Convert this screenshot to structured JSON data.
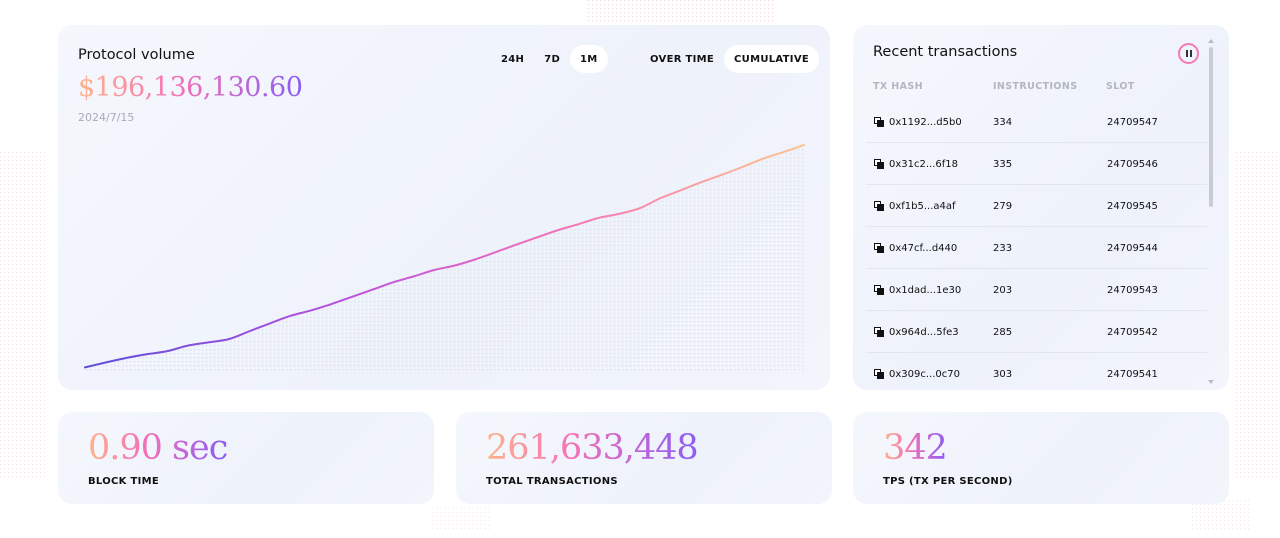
{
  "volume": {
    "title": "Protocol volume",
    "amount": "$196,136,130.60",
    "date": "2024/7/15",
    "range_options": [
      "24H",
      "7D",
      "1M"
    ],
    "range_selected": "1M",
    "mode_options": [
      "OVER TIME",
      "CUMULATIVE"
    ],
    "mode_selected": "CUMULATIVE"
  },
  "chart_data": {
    "type": "line",
    "title": "",
    "xlabel": "",
    "ylabel": "",
    "grid": false,
    "legend": "none",
    "colors": [
      "#5b4fd8",
      "#b44fe0",
      "#f472b6",
      "#ffc490"
    ],
    "series": [
      {
        "name": "",
        "values": [
          4.0,
          8.2,
          12.1,
          15.3,
          18.0,
          22.8,
          25.6,
          28.4,
          35.2,
          42.0,
          48.5,
          53.2,
          58.7,
          65.0,
          71.2,
          77.5,
          82.6,
          88.1,
          92.0,
          97.3,
          103.6,
          110.1,
          116.3,
          122.4,
          127.6,
          133.1,
          136.6,
          141.5,
          150.1,
          157.0,
          164.0,
          170.3,
          177.1,
          184.3,
          190.0,
          196.1
        ]
      }
    ]
  },
  "transactions": {
    "title": "Recent transactions",
    "pause_icon": "pause-icon",
    "columns": [
      "TX HASH",
      "INSTRUCTIONS",
      "SLOT"
    ],
    "rows": [
      {
        "hash": "0x1192...d5b0",
        "instructions": "334",
        "slot": "24709547"
      },
      {
        "hash": "0x31c2...6f18",
        "instructions": "335",
        "slot": "24709546"
      },
      {
        "hash": "0xf1b5...a4af",
        "instructions": "279",
        "slot": "24709545"
      },
      {
        "hash": "0x47cf...d440",
        "instructions": "233",
        "slot": "24709544"
      },
      {
        "hash": "0x1dad...1e30",
        "instructions": "203",
        "slot": "24709543"
      },
      {
        "hash": "0x964d...5fe3",
        "instructions": "285",
        "slot": "24709542"
      },
      {
        "hash": "0x309c...0c70",
        "instructions": "303",
        "slot": "24709541"
      }
    ]
  },
  "stats": {
    "block_time": {
      "value": "0.90 sec",
      "label": "BLOCK TIME"
    },
    "total_transactions": {
      "value": "261,633,448",
      "label": "TOTAL TRANSACTIONS"
    },
    "tps": {
      "value": "342",
      "label": "TPS (TX PER SECOND)"
    }
  }
}
